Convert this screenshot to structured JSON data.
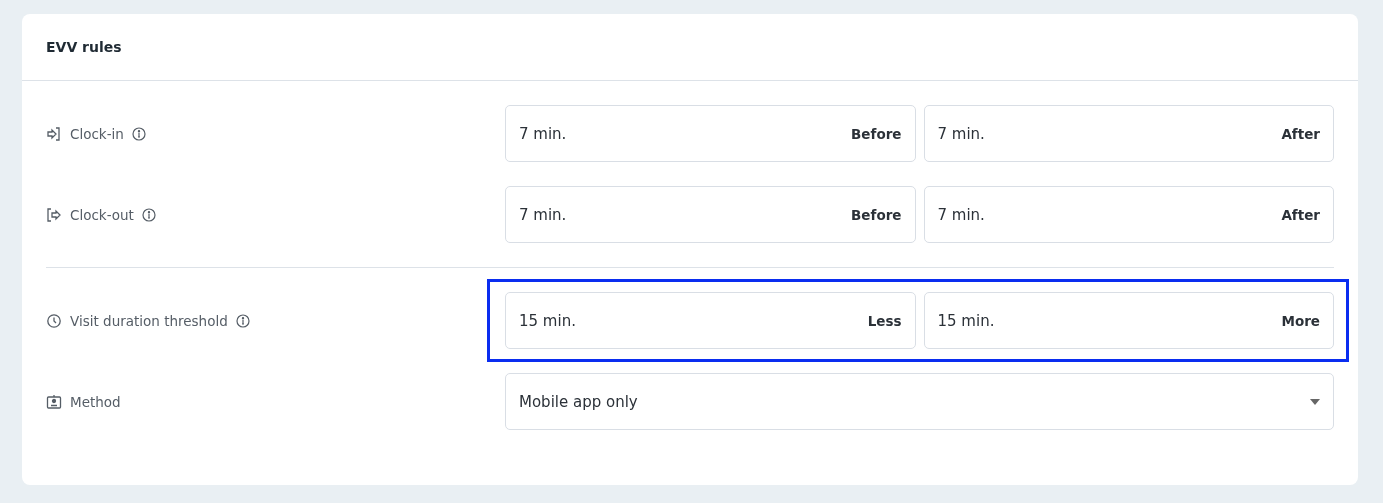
{
  "card": {
    "title": "EVV rules"
  },
  "rules": [
    {
      "kind": "pair",
      "label": "Clock-in",
      "info": true,
      "divider_before": false,
      "highlighted": false,
      "fields": [
        {
          "value": "7 min.",
          "suffix": "Before"
        },
        {
          "value": "7 min.",
          "suffix": "After"
        }
      ]
    },
    {
      "kind": "pair",
      "label": "Clock-out",
      "info": true,
      "divider_before": false,
      "highlighted": false,
      "fields": [
        {
          "value": "7 min.",
          "suffix": "Before"
        },
        {
          "value": "7 min.",
          "suffix": "After"
        }
      ]
    },
    {
      "kind": "pair",
      "label": "Visit duration threshold",
      "info": true,
      "divider_before": true,
      "highlighted": true,
      "fields": [
        {
          "value": "15 min.",
          "suffix": "Less"
        },
        {
          "value": "15 min.",
          "suffix": "More"
        }
      ]
    },
    {
      "kind": "select",
      "label": "Method",
      "info": false,
      "divider_before": false,
      "highlighted": false,
      "value": "Mobile app only"
    }
  ]
}
